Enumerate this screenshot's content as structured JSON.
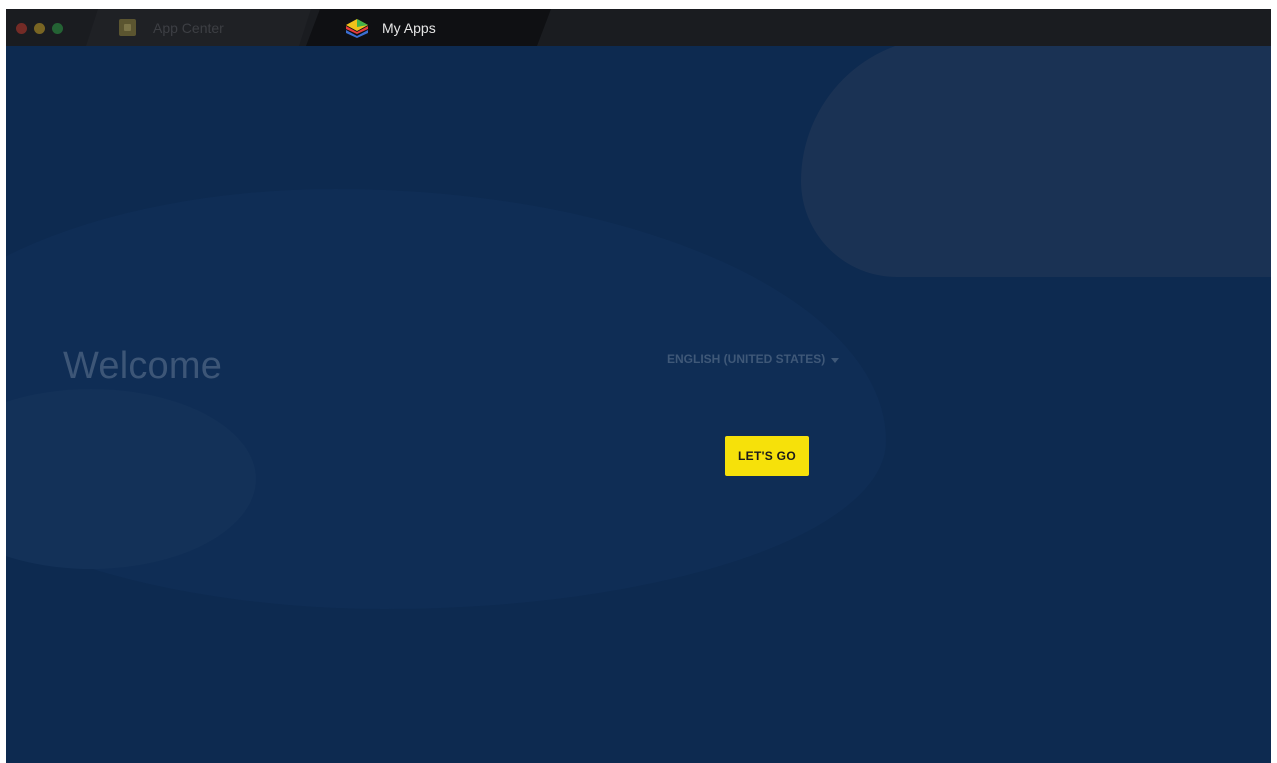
{
  "window": {
    "tabs": [
      {
        "label": "App Center",
        "icon": "store-icon",
        "active": false
      },
      {
        "label": "My Apps",
        "icon": "layers-icon",
        "active": true
      }
    ]
  },
  "welcome": {
    "title": "Welcome",
    "language": "ENGLISH (UNITED STATES)",
    "cta_label": "LET'S GO"
  },
  "colors": {
    "background": "#0d2a50",
    "titlebar": "#1a1c20",
    "cta": "#f6e10a"
  }
}
